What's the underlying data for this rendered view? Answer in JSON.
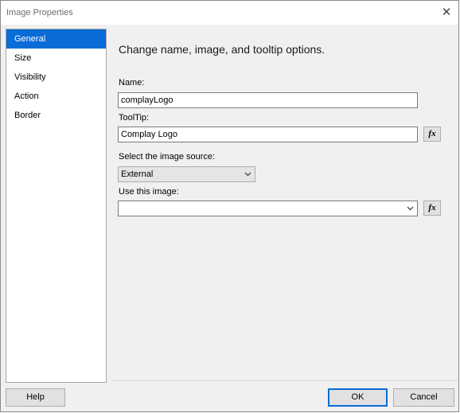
{
  "window": {
    "title": "Image Properties",
    "close_glyph": "✕"
  },
  "sidebar": {
    "items": [
      {
        "label": "General",
        "selected": true
      },
      {
        "label": "Size",
        "selected": false
      },
      {
        "label": "Visibility",
        "selected": false
      },
      {
        "label": "Action",
        "selected": false
      },
      {
        "label": "Border",
        "selected": false
      }
    ]
  },
  "main": {
    "heading": "Change name, image, and tooltip options.",
    "name_label": "Name:",
    "name_value": "complayLogo",
    "tooltip_label": "ToolTip:",
    "tooltip_value": "Complay Logo",
    "fx_label": "fx",
    "source_label": "Select the image source:",
    "source_value": "External",
    "use_image_label": "Use this image:",
    "use_image_value": ""
  },
  "footer": {
    "help_label": "Help",
    "ok_label": "OK",
    "cancel_label": "Cancel"
  },
  "colors": {
    "accent": "#0a6cd6",
    "dialog_bg": "#f0f0f0"
  }
}
